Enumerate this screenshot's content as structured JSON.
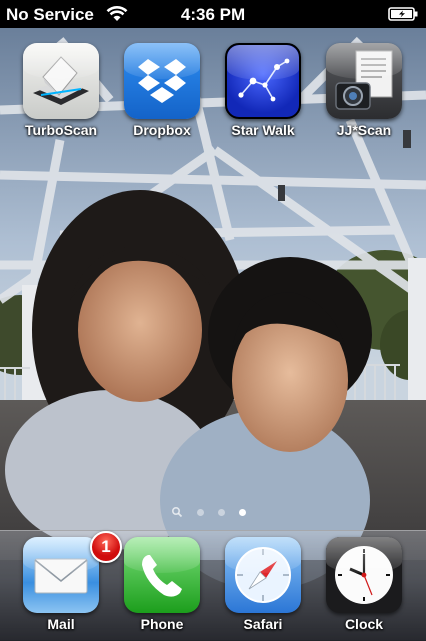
{
  "status_bar": {
    "carrier": "No Service",
    "time": "4:36 PM",
    "wifi_icon": "wifi-icon",
    "battery_icon": "battery-charging-icon"
  },
  "home_screen": {
    "apps": [
      {
        "label": "TurboScan",
        "icon": "scanner-icon"
      },
      {
        "label": "Dropbox",
        "icon": "dropbox-box-icon"
      },
      {
        "label": "Star Walk",
        "icon": "constellation-icon"
      },
      {
        "label": "JJ*Scan",
        "icon": "camera-document-icon"
      }
    ],
    "page_indicator": {
      "pages": 3,
      "current_page": 3,
      "search_page": "search-icon"
    }
  },
  "dock": {
    "apps": [
      {
        "label": "Mail",
        "icon": "mail-envelope-icon",
        "badge": "1"
      },
      {
        "label": "Phone",
        "icon": "phone-handset-icon"
      },
      {
        "label": "Safari",
        "icon": "compass-icon"
      },
      {
        "label": "Clock",
        "icon": "clock-icon"
      }
    ]
  },
  "colors": {
    "badge_red": "#d00c0c",
    "dropbox_blue": "#1b7ae0",
    "phone_green": "#2fb52f",
    "starwalk_blue": "#1d33d6"
  }
}
